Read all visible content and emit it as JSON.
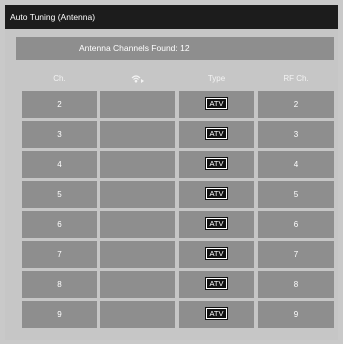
{
  "window": {
    "title": "Auto Tuning (Antenna)"
  },
  "summary": {
    "found_text": "Antenna Channels Found: 12"
  },
  "columns": {
    "channel": "Ch.",
    "signal_icon": "antenna-signal-icon",
    "type": "Type",
    "rf": "RF Ch."
  },
  "rows": [
    {
      "ch": "2",
      "type": "ATV",
      "rf": "2"
    },
    {
      "ch": "3",
      "type": "ATV",
      "rf": "3"
    },
    {
      "ch": "4",
      "type": "ATV",
      "rf": "4"
    },
    {
      "ch": "5",
      "type": "ATV",
      "rf": "5"
    },
    {
      "ch": "6",
      "type": "ATV",
      "rf": "6"
    },
    {
      "ch": "7",
      "type": "ATV",
      "rf": "7"
    },
    {
      "ch": "8",
      "type": "ATV",
      "rf": "8"
    },
    {
      "ch": "9",
      "type": "ATV",
      "rf": "9"
    }
  ],
  "colors": {
    "title_bar": "#1c1c1c",
    "panel": "#c6c6c6",
    "cell": "#8e8e8e",
    "text": "#ffffff"
  }
}
